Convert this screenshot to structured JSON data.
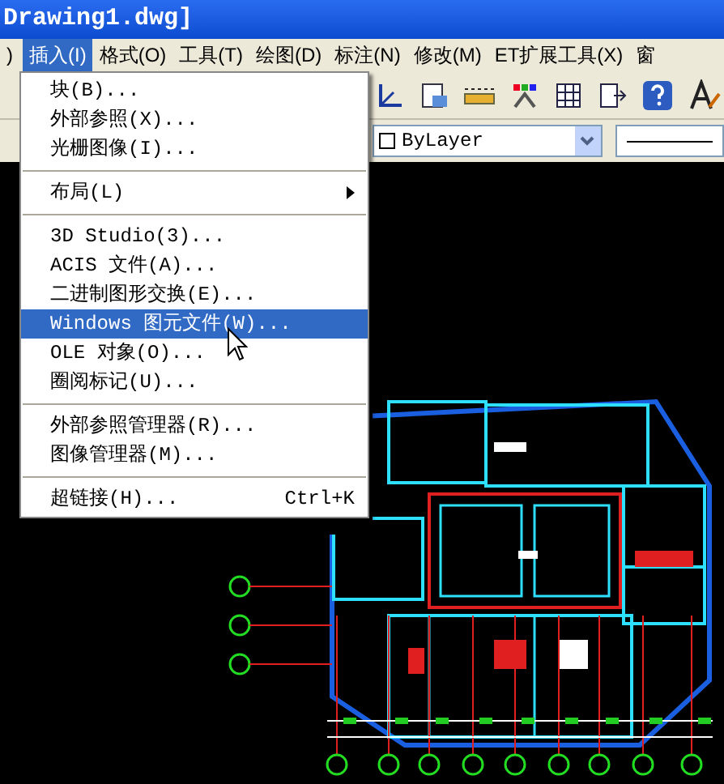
{
  "window": {
    "title": "Drawing1.dwg]"
  },
  "menu_bar": [
    {
      "label": ")",
      "selected": false
    },
    {
      "label": "插入(I)",
      "selected": true
    },
    {
      "label": "格式(O)",
      "selected": false
    },
    {
      "label": "工具(T)",
      "selected": false
    },
    {
      "label": "绘图(D)",
      "selected": false
    },
    {
      "label": "标注(N)",
      "selected": false
    },
    {
      "label": "修改(M)",
      "selected": false
    },
    {
      "label": "ET扩展工具(X)",
      "selected": false
    },
    {
      "label": "窗",
      "selected": false
    }
  ],
  "properties_toolbar": {
    "color_dropdown": "ByLayer"
  },
  "insert_menu": [
    {
      "kind": "item",
      "label": "块(B)...",
      "selected": false
    },
    {
      "kind": "item",
      "label": "外部参照(X)...",
      "selected": false
    },
    {
      "kind": "item",
      "label": "光栅图像(I)...",
      "selected": false
    },
    {
      "kind": "separator"
    },
    {
      "kind": "submenu",
      "label": "布局(L)",
      "selected": false
    },
    {
      "kind": "separator"
    },
    {
      "kind": "item",
      "label": "3D Studio(3)...",
      "selected": false
    },
    {
      "kind": "item",
      "label": "ACIS 文件(A)...",
      "selected": false
    },
    {
      "kind": "item",
      "label": "二进制图形交换(E)...",
      "selected": false
    },
    {
      "kind": "item",
      "label": "Windows 图元文件(W)...",
      "selected": true
    },
    {
      "kind": "item",
      "label": "OLE 对象(O)...",
      "selected": false
    },
    {
      "kind": "item",
      "label": "圈阅标记(U)...",
      "selected": false
    },
    {
      "kind": "separator"
    },
    {
      "kind": "item",
      "label": "外部参照管理器(R)...",
      "selected": false
    },
    {
      "kind": "item",
      "label": "图像管理器(M)...",
      "selected": false
    },
    {
      "kind": "separator"
    },
    {
      "kind": "item",
      "label": "超链接(H)...",
      "shortcut": "Ctrl+K",
      "selected": false
    }
  ]
}
